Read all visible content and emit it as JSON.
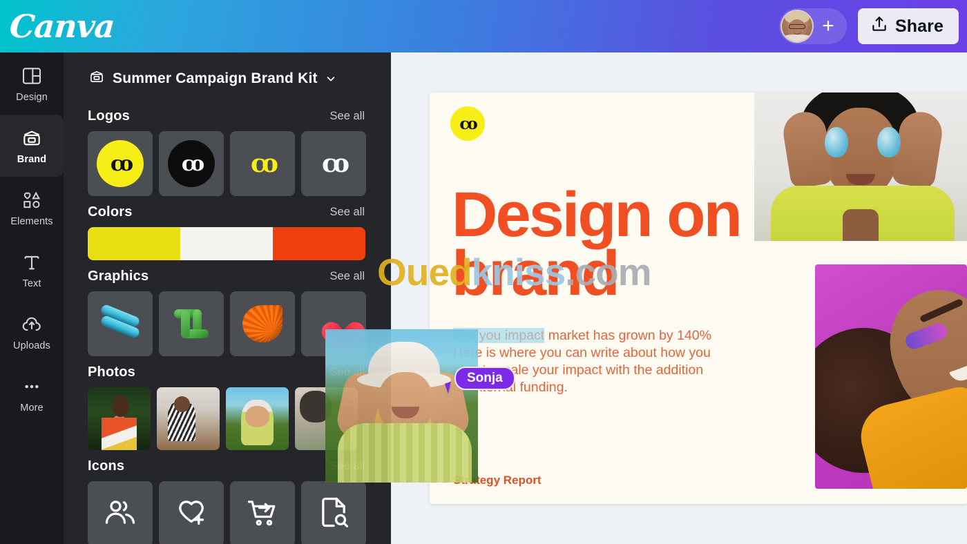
{
  "topbar": {
    "logo_text": "Canva",
    "avatar_name": "avatar",
    "add_label": "+",
    "share_label": "Share",
    "share_icon": "upload-icon",
    "gradient_start": "#00c4cc",
    "gradient_end": "#6c3fe8"
  },
  "rail": {
    "items": [
      {
        "label": "Design",
        "icon": "layout-icon",
        "active": false
      },
      {
        "label": "Brand",
        "icon": "wallet-icon",
        "active": true
      },
      {
        "label": "Elements",
        "icon": "shapes-icon",
        "active": false
      },
      {
        "label": "Text",
        "icon": "text-t-icon",
        "active": false
      },
      {
        "label": "Uploads",
        "icon": "cloud-up-icon",
        "active": false
      },
      {
        "label": "More",
        "icon": "ellipsis-icon",
        "active": false
      }
    ]
  },
  "panel": {
    "kit_title": "Summer Campaign Brand Kit",
    "kit_icon": "brand-kit-wallet-icon",
    "chevron_icon": "chevron-down-icon",
    "see_all_label": "See all",
    "sections": [
      {
        "title": "Logos"
      },
      {
        "title": "Colors"
      },
      {
        "title": "Graphics"
      },
      {
        "title": "Photos"
      },
      {
        "title": "Icons"
      }
    ],
    "logos": [
      {
        "name": "logo-yellow-circle",
        "bg": "#f7ee18",
        "fg": "#111111"
      },
      {
        "name": "logo-black-circle",
        "bg": "#0d0d0d",
        "fg": "#ffffff"
      },
      {
        "name": "logo-yellow-mark",
        "bg": "transparent",
        "fg": "#f7ee18"
      },
      {
        "name": "logo-white-mark",
        "bg": "transparent",
        "fg": "#ffffff"
      }
    ],
    "logo_mark_text": "co",
    "colors": [
      {
        "name": "brand-yellow",
        "hex": "#e8de12"
      },
      {
        "name": "brand-white",
        "hex": "#f4f3ef"
      },
      {
        "name": "brand-orange",
        "hex": "#f0400f"
      }
    ],
    "graphics": [
      {
        "name": "graphic-blue-clips"
      },
      {
        "name": "graphic-green-square"
      },
      {
        "name": "graphic-orange-fan"
      },
      {
        "name": "graphic-red-heart"
      }
    ],
    "photos": [
      {
        "name": "photo-woman-orange-jacket"
      },
      {
        "name": "photo-woman-laptop"
      },
      {
        "name": "photo-woman-white-hat"
      },
      {
        "name": "photo-group-outdoors"
      }
    ],
    "icons": [
      {
        "name": "users-group-icon"
      },
      {
        "name": "heart-plus-icon"
      },
      {
        "name": "cart-arrow-icon"
      },
      {
        "name": "document-search-icon"
      }
    ]
  },
  "canvas": {
    "logo_badge_text": "co",
    "headline": "Design on brand",
    "body_selected": "Our you impact",
    "body_text": "market has grown by 140% Here is where you can write about how you plan to scale your impact with the addition of external funding.",
    "body_full": "Our market has grown by 140% Here is where you can write about how you plan to scale your impact with the addition of external funding.",
    "footnote": "Strategy Report",
    "headline_color": "#f04e23",
    "body_color": "#e2663a",
    "card_bg": "#fdfaf2",
    "photo_top_right": "photo-woman-blue-eggs",
    "photo_bottom_right": "photo-woman-magenta-backdrop",
    "dragged_photo": "photo-woman-white-hat-dragging"
  },
  "collaborator": {
    "name": "Sonja",
    "color": "#7d2ae8",
    "cursor_icon": "pointer-cursor-icon"
  },
  "watermark": {
    "part_a": "Oued",
    "part_b": "kniss",
    "part_c": ".com",
    "color_a": "#e0b322",
    "color_b": "#9cc8e0",
    "color_c": "#a9aeb2"
  }
}
